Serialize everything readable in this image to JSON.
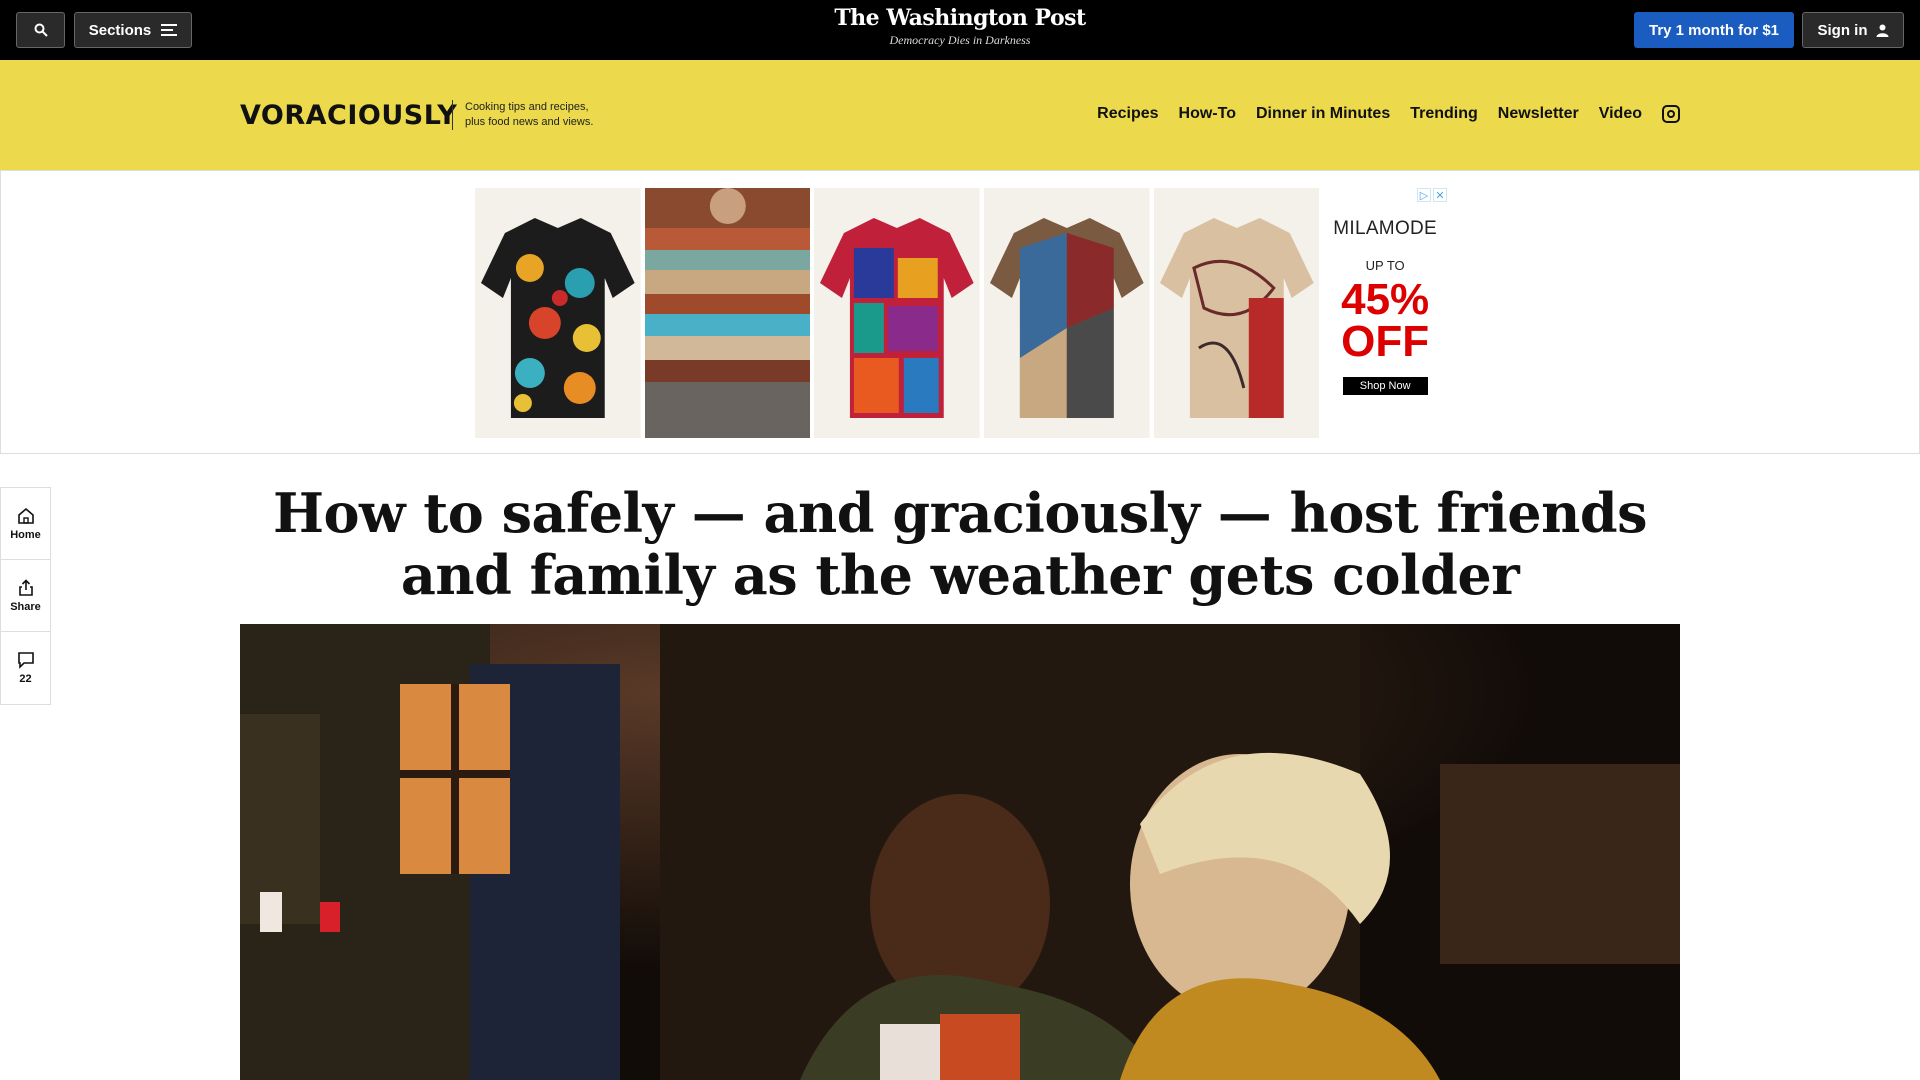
{
  "topbar": {
    "sections_label": "Sections",
    "logo": "The Washington Post",
    "tagline": "Democracy Dies in Darkness",
    "try_label": "Try 1 month for $1",
    "signin_label": "Sign in"
  },
  "section": {
    "logo": "VORACIOUSLY",
    "tagline_line1": "Cooking tips and recipes,",
    "tagline_line2": "plus food news and views.",
    "nav": [
      "Recipes",
      "How-To",
      "Dinner in Minutes",
      "Trending",
      "Newsletter",
      "Video"
    ]
  },
  "ad": {
    "brand": "MILAMODE",
    "up_to": "UP TO",
    "discount": "45%",
    "off": "OFF",
    "cta": "Shop Now"
  },
  "rail": {
    "home_label": "Home",
    "share_label": "Share",
    "comments_count": "22"
  },
  "article": {
    "headline": "How to safely — and graciously — host friends and family as the weather gets colder"
  },
  "colors": {
    "section_band": "#ecd94c",
    "try_button": "#1a5cbf",
    "ad_discount": "#dd0000"
  }
}
